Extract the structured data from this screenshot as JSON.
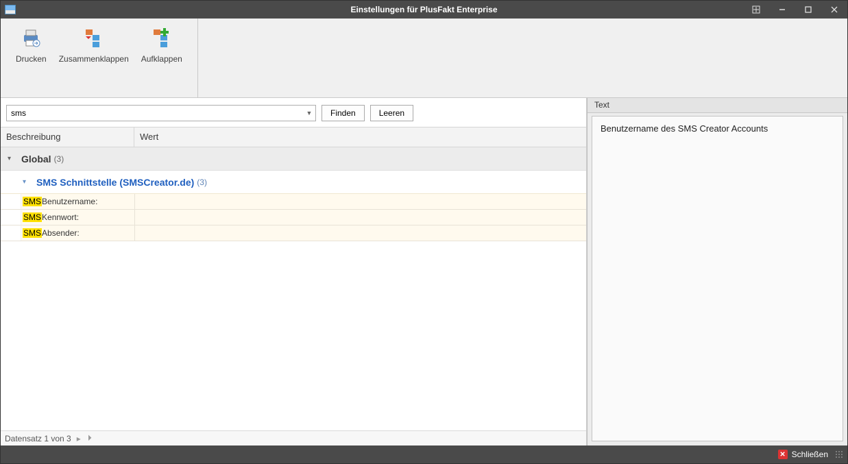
{
  "window": {
    "title": "Einstellungen für PlusFakt Enterprise"
  },
  "ribbon": {
    "print": "Drucken",
    "collapse": "Zusammenklappen",
    "expand": "Aufklappen"
  },
  "search": {
    "value": "sms",
    "find_label": "Finden",
    "clear_label": "Leeren"
  },
  "columns": {
    "description": "Beschreibung",
    "value": "Wert"
  },
  "groups": {
    "global": {
      "name": "Global",
      "count": "(3)"
    },
    "sms": {
      "name": "SMS Schnittstelle (SMSCreator.de)",
      "count": "(3)"
    }
  },
  "rows": [
    {
      "highlight": "SMS",
      "rest": " Benutzername:"
    },
    {
      "highlight": "SMS",
      "rest": " Kennwort:"
    },
    {
      "highlight": "SMS",
      "rest": " Absender:"
    }
  ],
  "paginator": {
    "text": "Datensatz 1 von 3"
  },
  "side": {
    "header": "Text",
    "body": "Benutzername des SMS Creator Accounts"
  },
  "footer": {
    "close": "Schließen"
  }
}
